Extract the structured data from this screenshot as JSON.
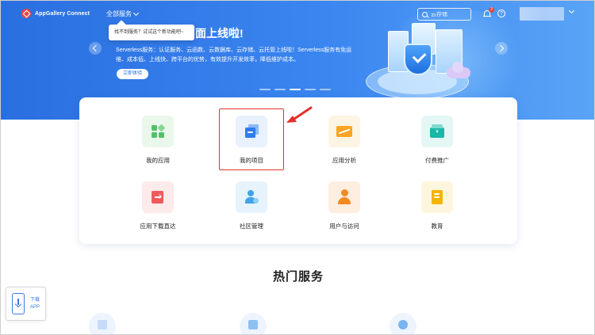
{
  "header": {
    "logo_text": "AppGallery Connect",
    "all_services": "全部服务",
    "tooltip": "找不到服务？试试这个新功能吧~",
    "search_placeholder": "云存储",
    "notification_count": "3",
    "help_label": "?"
  },
  "banner": {
    "title": "面上线啦!",
    "description": "Serverless服务：认证服务、云函数、云数据库、云存储、云托管上线啦！Serverless服务有免运维、成本低、上线快、跨平台的优势，有效提升开发效率，降低维护成本。",
    "button": "立即体验",
    "slides": 5,
    "active_slide": 3
  },
  "services": [
    {
      "label": "我的应用",
      "icon": "apps-grid-icon",
      "color": "#54c16a",
      "bg": "#eaf8ec"
    },
    {
      "label": "我的项目",
      "icon": "projects-icon",
      "color": "#2f7cf0",
      "bg": "#e8f1fd"
    },
    {
      "label": "应用分析",
      "icon": "analytics-icon",
      "color": "#f6a623",
      "bg": "#fdf4e3"
    },
    {
      "label": "付费推广",
      "icon": "paid-promotion-icon",
      "color": "#18b7a7",
      "bg": "#e4f7f5"
    },
    {
      "label": "应用下载直达",
      "icon": "download-direct-icon",
      "color": "#f05a5a",
      "bg": "#fdeaea"
    },
    {
      "label": "社区管理",
      "icon": "community-icon",
      "color": "#3ea3e8",
      "bg": "#e6f3fc"
    },
    {
      "label": "用户与访问",
      "icon": "user-access-icon",
      "color": "#f28a22",
      "bg": "#fdeedf"
    },
    {
      "label": "教育",
      "icon": "education-icon",
      "color": "#f4b400",
      "bg": "#fdf5dd"
    }
  ],
  "hot_services_title": "热门服务",
  "download_app": {
    "line1": "下载",
    "line2": "APP"
  },
  "colors": {
    "primary": "#2a6fe0",
    "highlight": "#e5302b"
  }
}
